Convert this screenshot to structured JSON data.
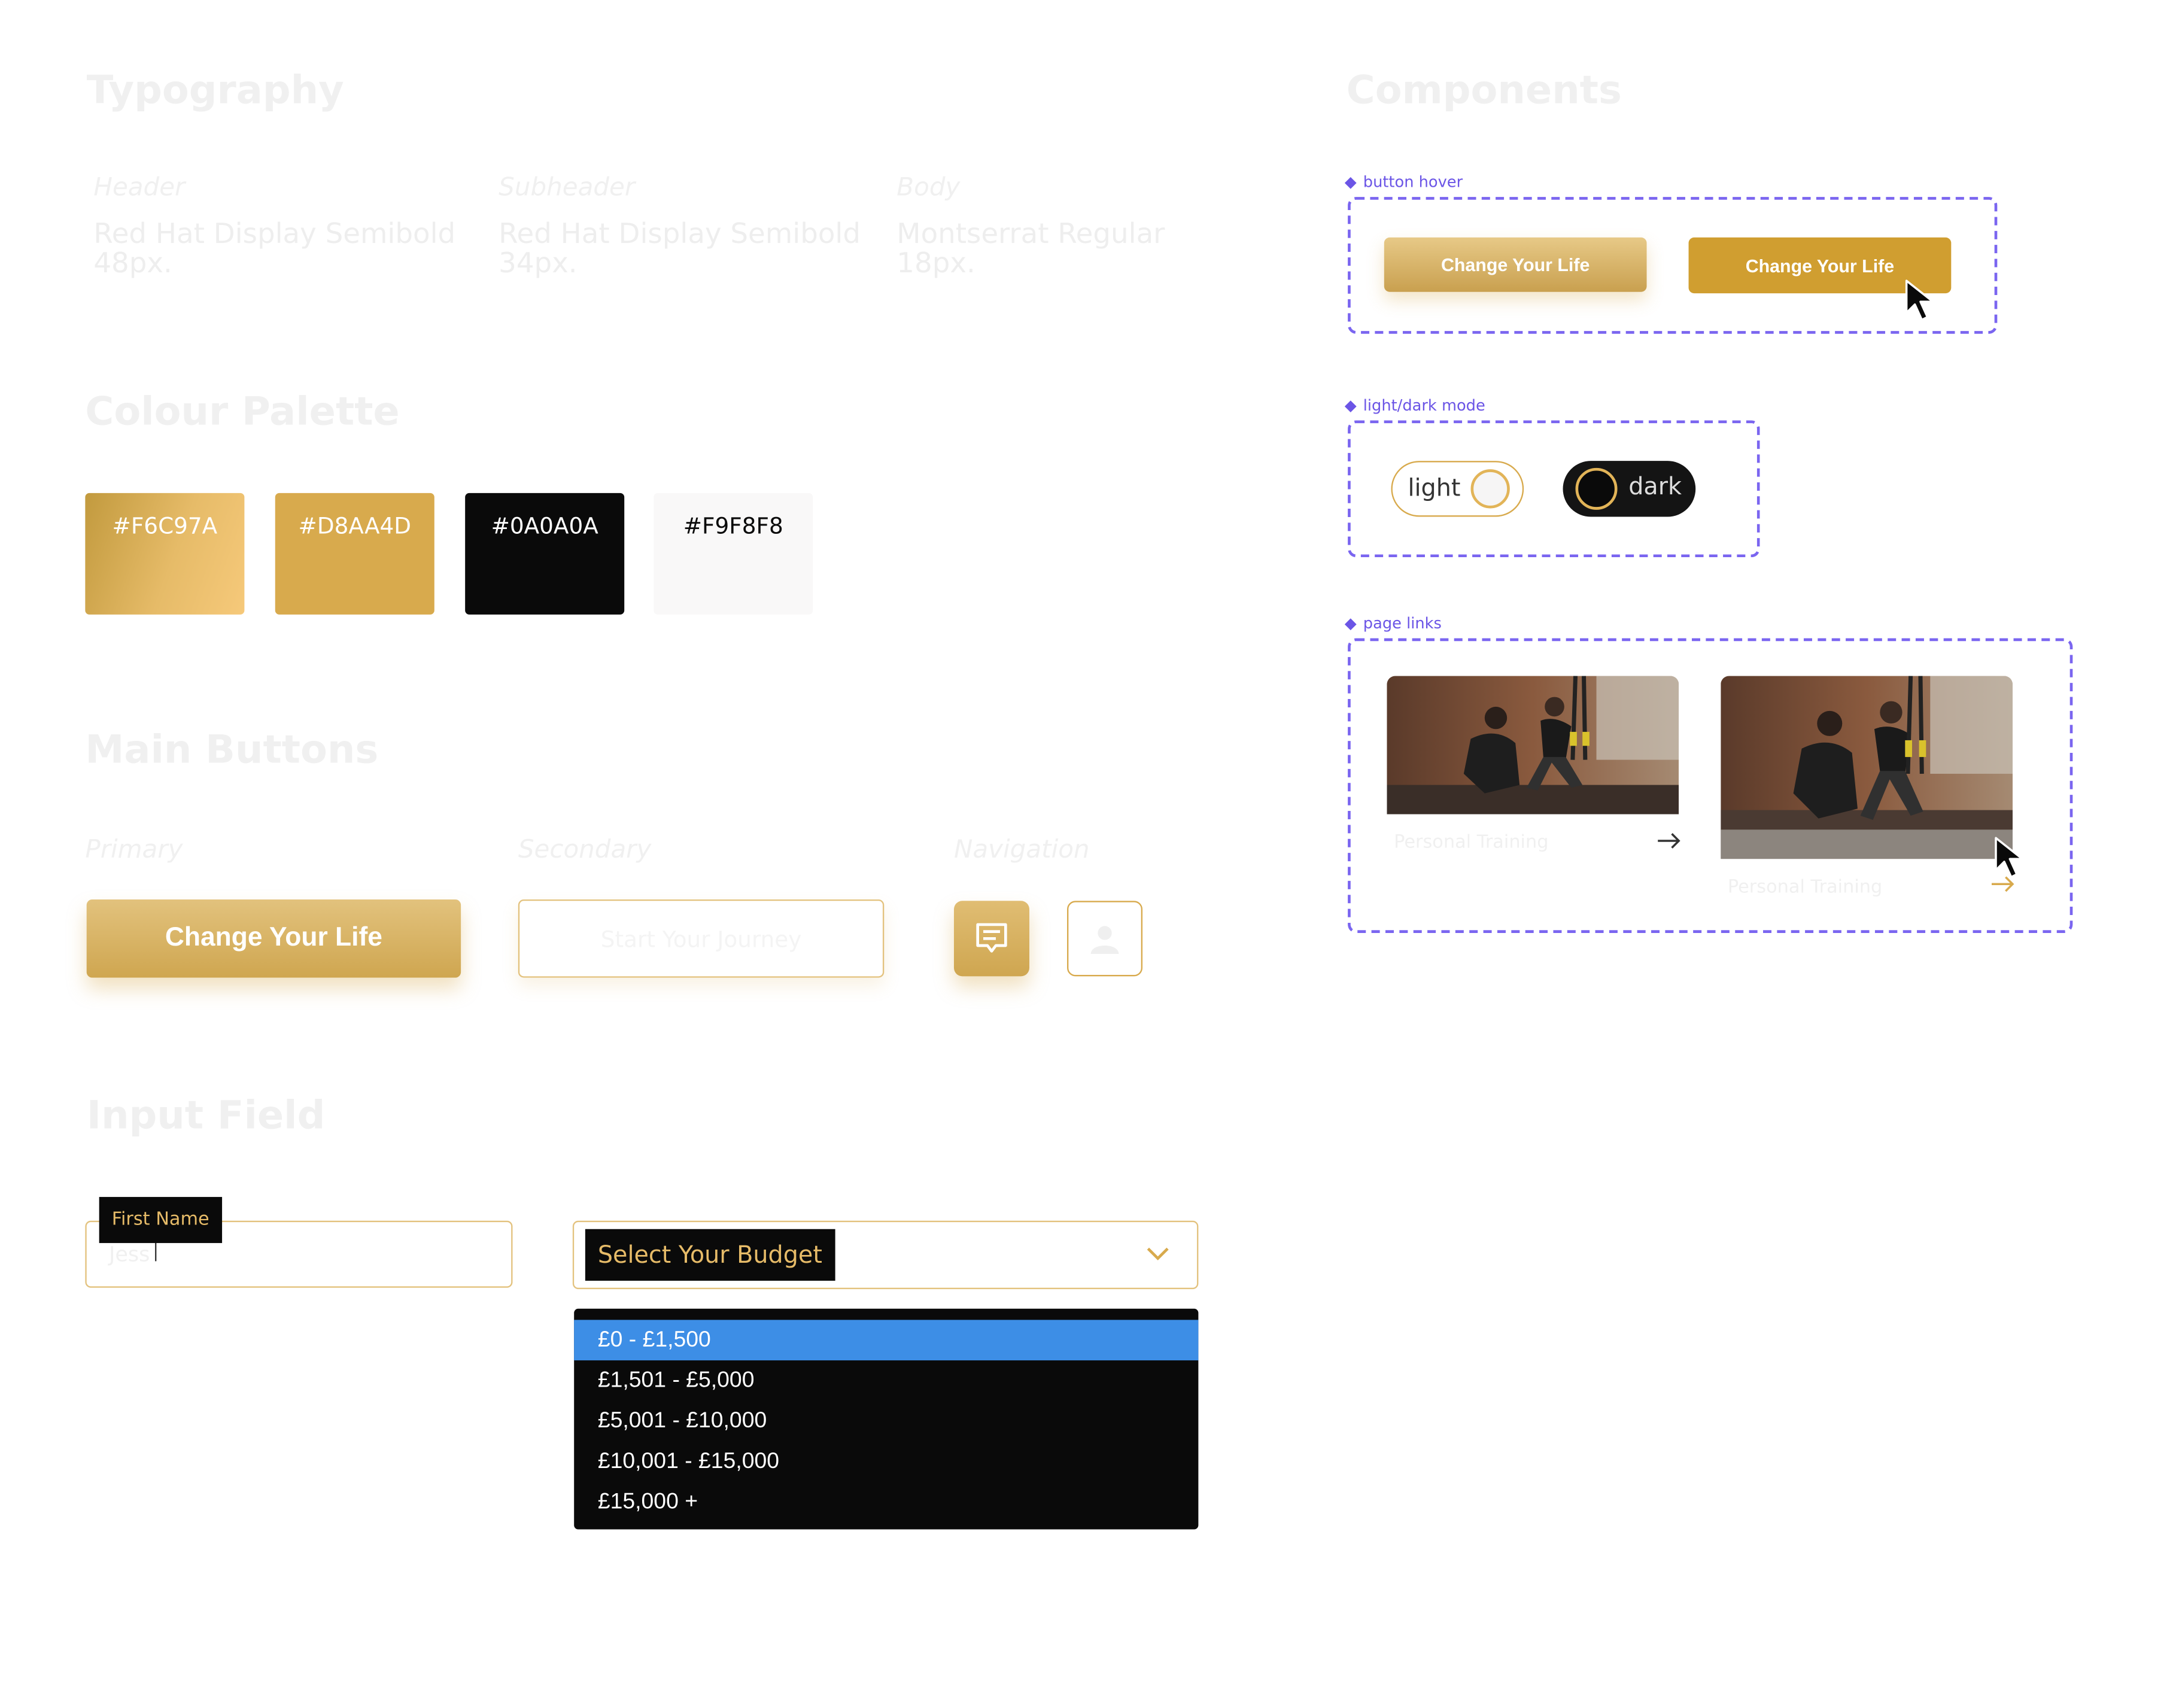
{
  "typography": {
    "title": "Typography",
    "columns": [
      {
        "label": "Header",
        "line1": "Red Hat Display Semibold",
        "line2": "48px."
      },
      {
        "label": "Subheader",
        "line1": "Red Hat Display Semibold",
        "line2": "34px."
      },
      {
        "label": "Body",
        "line1": "Montserrat Regular",
        "line2": "18px."
      }
    ]
  },
  "palette": {
    "title": "Colour Palette",
    "swatches": [
      {
        "label": "#F6C97A",
        "color": "#F6C97A"
      },
      {
        "label": "#D8AA4D",
        "color": "#D8AA4D"
      },
      {
        "label": "#0A0A0A",
        "color": "#0A0A0A"
      },
      {
        "label": "#F9F8F8",
        "color": "#F9F8F8"
      }
    ]
  },
  "main_buttons": {
    "title": "Main Buttons",
    "primary_label": "Primary",
    "secondary_label": "Secondary",
    "navigation_label": "Navigation",
    "primary_button": "Change Your Life",
    "secondary_button": "Start Your Journey",
    "nav_icons": [
      "message-icon",
      "user-icon"
    ]
  },
  "input_field": {
    "title": "Input Field",
    "first_name_label": "First Name",
    "first_name_value": "Jess",
    "budget_label": "Select Your Budget",
    "budget_options": [
      "£0 - £1,500",
      "£1,501 - £5,000",
      "£5,001 - £10,000",
      "£10,001 - £15,000",
      "£15,000 +"
    ],
    "selected_index": 0
  },
  "components": {
    "title": "Components",
    "button_hover": {
      "label": "button hover",
      "normal": "Change Your Life",
      "hover": "Change Your Life"
    },
    "mode": {
      "label": "light/dark mode",
      "light": "light",
      "dark": "dark"
    },
    "page_links": {
      "label": "page links",
      "card1_caption": "Personal Training",
      "card2_caption": "Personal Training"
    }
  },
  "colors": {
    "gold_light": "#F6C97A",
    "gold": "#D8AA4D",
    "black": "#0A0A0A",
    "offwhite": "#F9F8F8",
    "accent_purple": "#7A65F0",
    "select_blue": "#3D8EE6"
  }
}
